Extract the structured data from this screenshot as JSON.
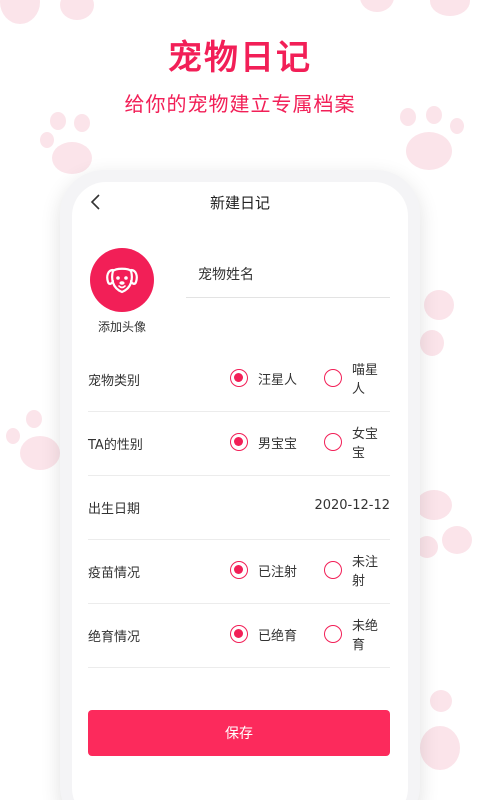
{
  "hero": {
    "title": "宠物日记",
    "subtitle": "给你的宠物建立专属档案"
  },
  "nav": {
    "title": "新建日记",
    "back_icon": "chevron-left-icon"
  },
  "avatar": {
    "label": "添加头像",
    "icon": "dog-face-icon",
    "color": "#f21f57"
  },
  "name_field": {
    "placeholder": "宠物姓名",
    "value": ""
  },
  "form": {
    "pet_type": {
      "label": "宠物类别",
      "options": [
        "汪星人",
        "喵星人"
      ],
      "selected": "汪星人"
    },
    "gender": {
      "label": "TA的性别",
      "options": [
        "男宝宝",
        "女宝宝"
      ],
      "selected": "男宝宝"
    },
    "birthday": {
      "label": "出生日期",
      "value": "2020-12-12"
    },
    "vaccine": {
      "label": "疫苗情况",
      "options": [
        "已注射",
        "未注射"
      ],
      "selected": "已注射"
    },
    "neuter": {
      "label": "绝育情况",
      "options": [
        "已绝育",
        "未绝育"
      ],
      "selected": "已绝育"
    }
  },
  "save_button": {
    "label": "保存"
  },
  "colors": {
    "accent": "#f21f57",
    "button": "#fc2a5c",
    "paw": "#fbe4ea"
  }
}
